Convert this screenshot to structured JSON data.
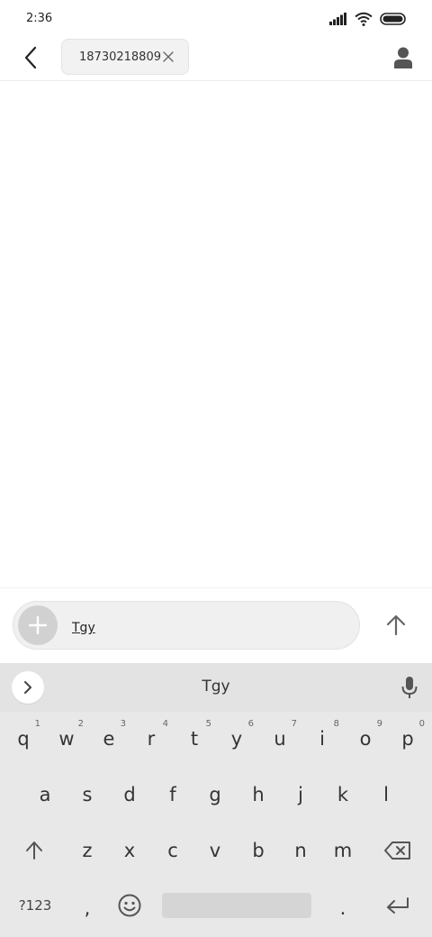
{
  "status_bar": {
    "time": "2:36",
    "icons": [
      "signal-icon",
      "wifi-icon",
      "battery-icon"
    ]
  },
  "header": {
    "back_icon": "back-arrow-icon",
    "recipient": "18730218809",
    "chip_close_icon": "close-icon",
    "contact_icon": "person-icon"
  },
  "compose": {
    "attach_icon": "plus-icon",
    "text": "Tgy",
    "send_icon": "send-arrow-icon"
  },
  "keyboard": {
    "expand_icon": "chevron-right-icon",
    "suggestion": "Tgy",
    "mic_icon": "microphone-icon",
    "row1": [
      "q",
      "w",
      "e",
      "r",
      "t",
      "y",
      "u",
      "i",
      "o",
      "p"
    ],
    "row1_hints": [
      "1",
      "2",
      "3",
      "4",
      "5",
      "6",
      "7",
      "8",
      "9",
      "0"
    ],
    "row2": [
      "a",
      "s",
      "d",
      "f",
      "g",
      "h",
      "j",
      "k",
      "l"
    ],
    "row3": [
      "z",
      "x",
      "c",
      "v",
      "b",
      "n",
      "m"
    ],
    "shift_icon": "shift-arrow-icon",
    "backspace_icon": "backspace-icon",
    "symbols_label": "?123",
    "comma_label": ",",
    "emoji_icon": "emoji-icon",
    "period_label": ".",
    "enter_icon": "enter-icon"
  },
  "colors": {
    "keyboard_bg": "#e8e8e8",
    "suggestion_bg": "#e3e3e3",
    "chip_bg": "#f2f2f2",
    "attach_bg": "#d1d1d1"
  }
}
